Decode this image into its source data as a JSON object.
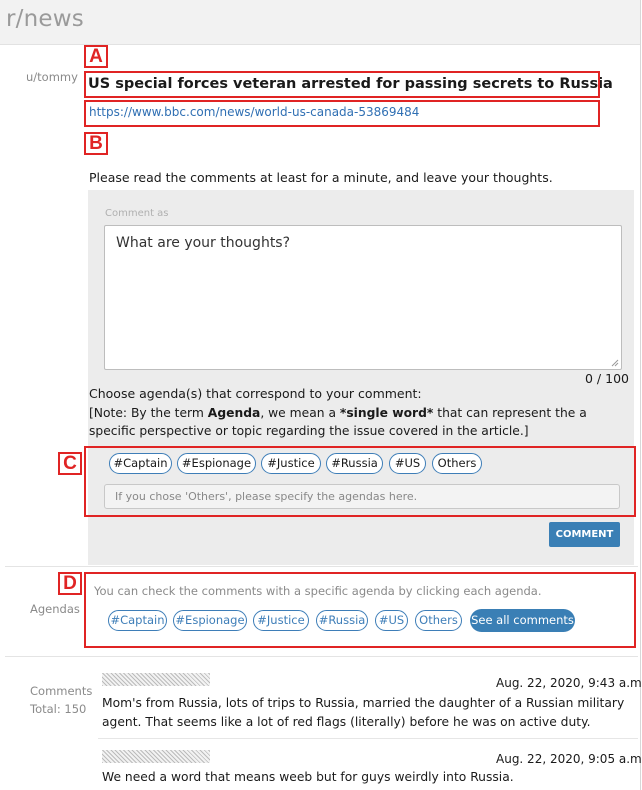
{
  "subreddit": "r/news",
  "post": {
    "author": "u/tommy",
    "title": "US special forces veteran arrested for passing secrets to Russia",
    "url": "https://www.bbc.com/news/world-us-canada-53869484"
  },
  "annotations": {
    "a": "A",
    "b": "B",
    "c": "C",
    "d": "D"
  },
  "comment_form": {
    "prompt": "Please read the comments at least for a minute, and leave your thoughts.",
    "comment_as": "Comment as",
    "placeholder": "What are your thoughts?",
    "counter": "0 / 100",
    "choose_label": "Choose agenda(s) that correspond to your comment:",
    "note": {
      "prefix": "[Note: By the term ",
      "term": "Agenda",
      "middle": ", we mean a ",
      "emphasis": "*single word*",
      "suffix": " that can represent the a specific perspective or topic regarding the issue covered in the article.]"
    },
    "tags": [
      "#Captain",
      "#Espionage",
      "#Justice",
      "#Russia",
      "#US",
      "Others"
    ],
    "others_placeholder": "If you chose 'Others', please specify the agendas here.",
    "submit_label": "COMMENT"
  },
  "agendas": {
    "label": "Agendas",
    "hint": "You can check the comments with a specific agenda by clicking each agenda.",
    "tags": [
      "#Captain",
      "#Espionage",
      "#Justice",
      "#Russia",
      "#US",
      "Others"
    ],
    "see_all_label": "See all comments"
  },
  "comments": {
    "label": "Comments",
    "total": "Total: 150",
    "items": [
      {
        "date": "Aug. 22, 2020, 9:43 a.m.",
        "text": "Mom's from Russia, lots of trips to Russia, married the daughter of a Russian military agent. That seems like a lot of red flags (literally) before he was on active duty."
      },
      {
        "date": "Aug. 22, 2020, 9:05 a.m.",
        "text": "We need a word that means weeb but for guys weirdly into Russia."
      }
    ]
  },
  "colors": {
    "accent_blue": "#3a7fb5",
    "tag_border": "#3e7eb8",
    "annotation_red": "#e02424",
    "link": "#2f6fb3"
  }
}
